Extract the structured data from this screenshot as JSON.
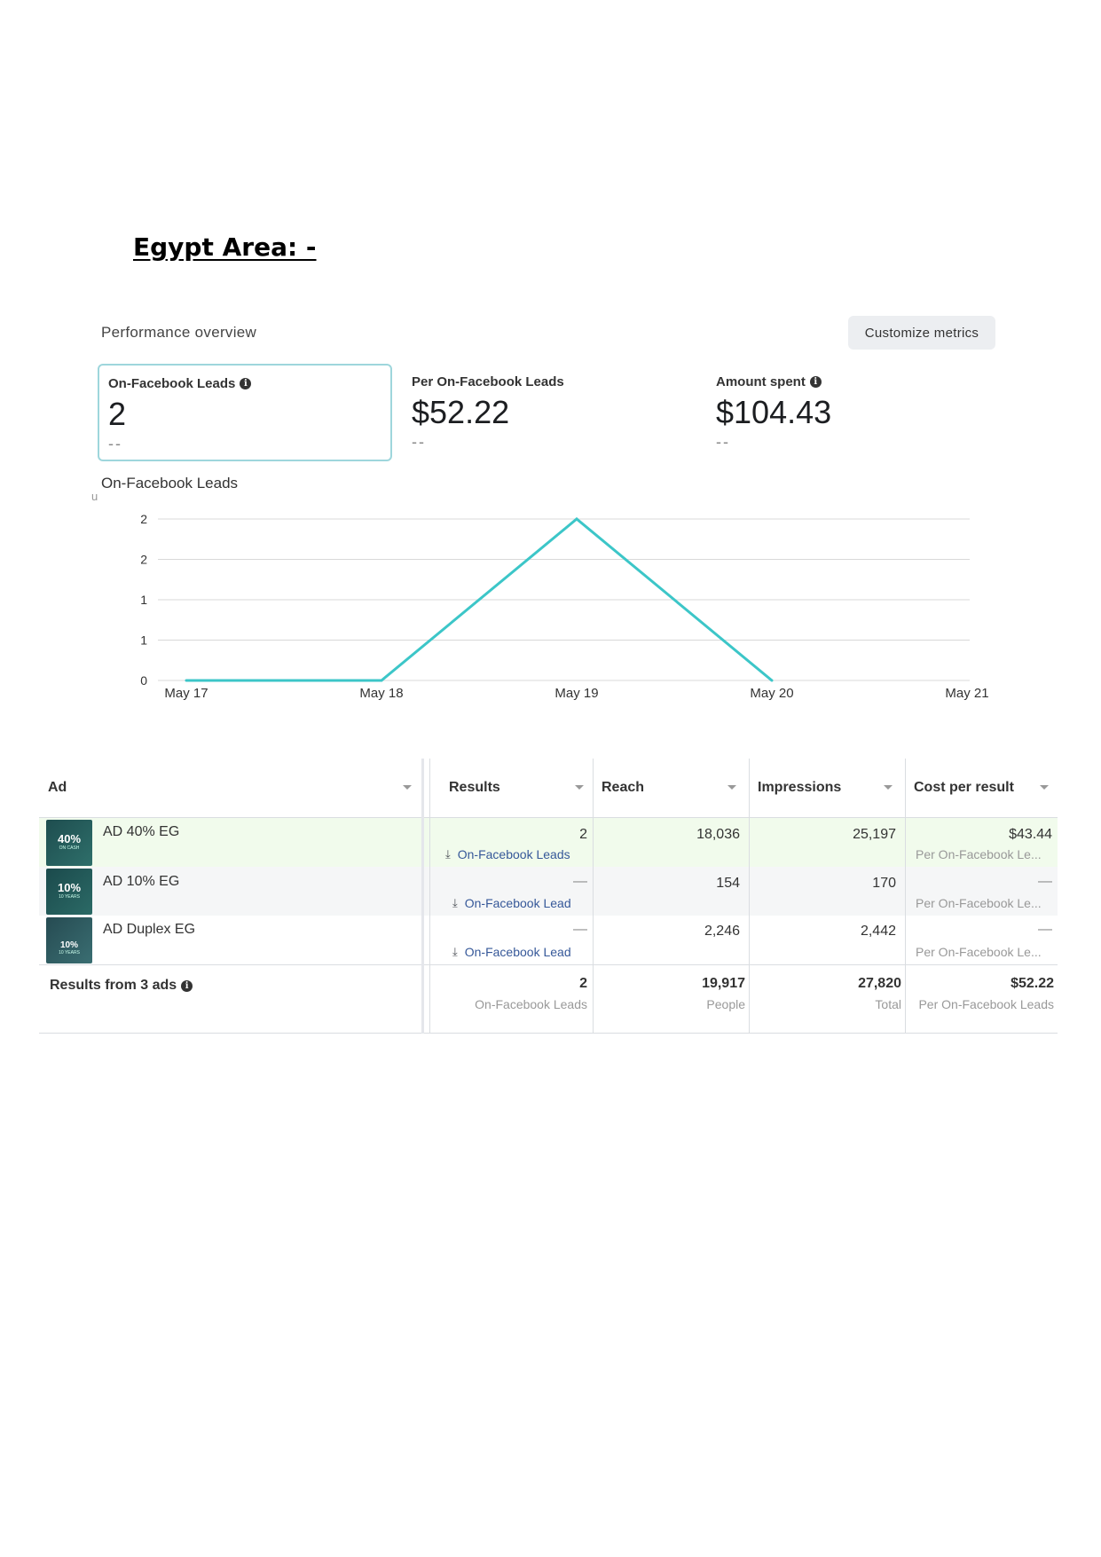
{
  "heading": "Egypt Area: -",
  "performance": {
    "title": "Performance overview",
    "customize_label": "Customize metrics",
    "metrics": [
      {
        "label": "On-Facebook Leads",
        "value": "2",
        "compare": "--",
        "info": true
      },
      {
        "label": "Per On-Facebook Leads",
        "value": "$52.22",
        "compare": "--",
        "info": false
      },
      {
        "label": "Amount spent",
        "value": "$104.43",
        "compare": "--",
        "info": true
      }
    ]
  },
  "chart_title": "On-Facebook Leads",
  "chart_stray": "u",
  "chart_data": {
    "type": "line",
    "title": "On-Facebook Leads",
    "x": [
      "May 17",
      "May 18",
      "May 19",
      "May 20",
      "May 21"
    ],
    "y_tick_labels": [
      "0",
      "1",
      "1",
      "2",
      "2"
    ],
    "ylim": [
      0,
      2
    ],
    "series": [
      {
        "values": [
          0,
          0,
          2,
          0,
          null
        ],
        "color": "#3cc6c8"
      }
    ],
    "grid": true
  },
  "table": {
    "headers": [
      "Ad",
      "Results",
      "Reach",
      "Impressions",
      "Cost per result"
    ],
    "rows": [
      {
        "name": "AD 40% EG",
        "thumb_text": "40%",
        "thumb_sub": "ON CASH",
        "results": "2",
        "results_sub": "On-Facebook Leads",
        "reach": "18,036",
        "impressions": "25,197",
        "cost": "$43.44",
        "cost_sub": "Per On-Facebook Le...",
        "highlight": true
      },
      {
        "name": "AD 10% EG",
        "thumb_text": "10%",
        "thumb_sub": "10 YEARS",
        "results": "—",
        "results_sub": "On-Facebook Lead",
        "reach": "154",
        "impressions": "170",
        "cost": "—",
        "cost_sub": "Per On-Facebook Le...",
        "highlight": false
      },
      {
        "name": "AD Duplex EG",
        "thumb_text": "10%",
        "thumb_sub": "10 YEARS",
        "results": "—",
        "results_sub": "On-Facebook Lead",
        "reach": "2,246",
        "impressions": "2,442",
        "cost": "—",
        "cost_sub": "Per On-Facebook Le...",
        "highlight": false
      }
    ],
    "summary": {
      "label": "Results from 3 ads",
      "results": "2",
      "results_sub": "On-Facebook Leads",
      "reach": "19,917",
      "reach_sub": "People",
      "impressions": "27,820",
      "impressions_sub": "Total",
      "cost": "$52.22",
      "cost_sub": "Per On-Facebook Leads"
    }
  },
  "colors": {
    "accent": "#3cc6c8",
    "highlight_row": "#f1fbec",
    "alt_row": "#f5f6f7",
    "link": "#365899"
  }
}
